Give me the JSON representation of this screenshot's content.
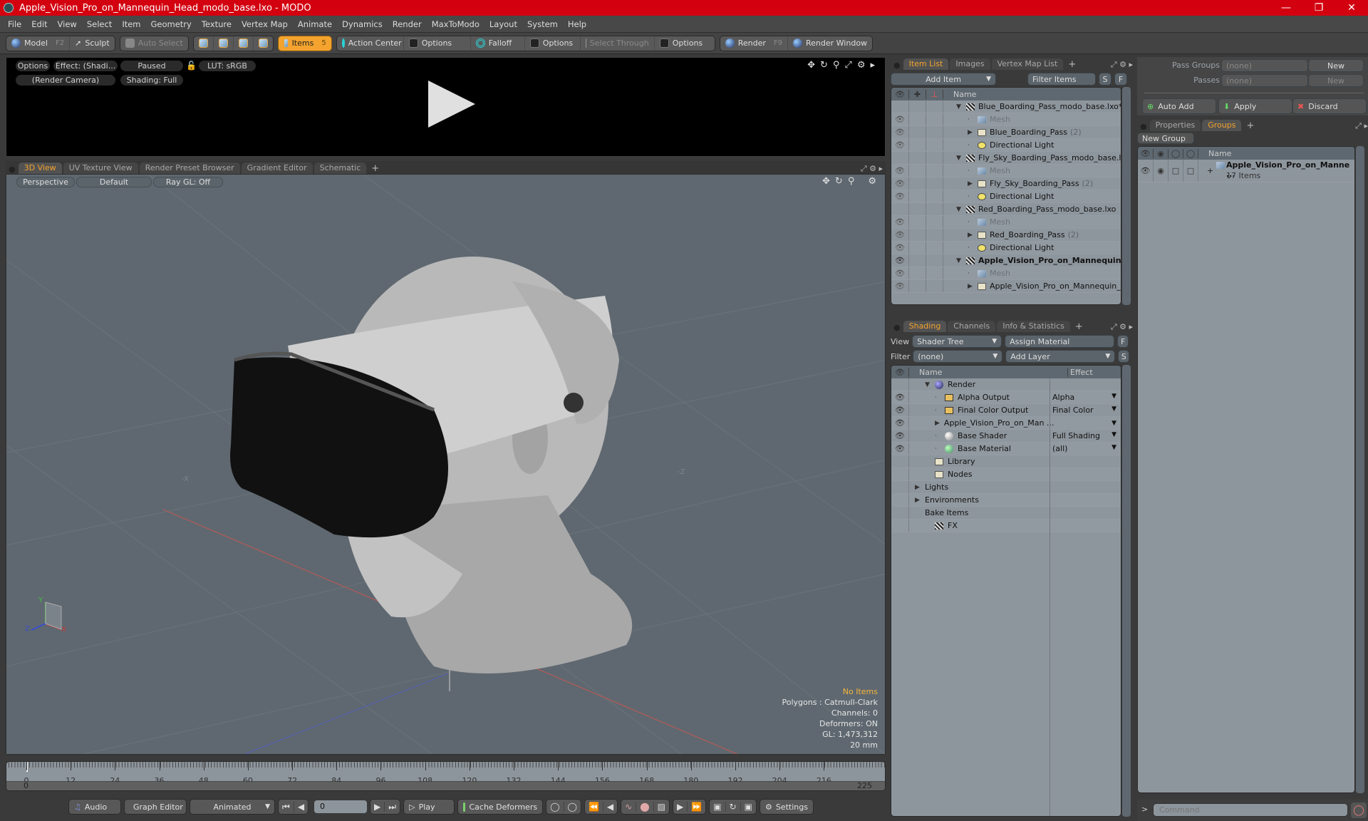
{
  "window": {
    "title": "Apple_Vision_Pro_on_Mannequin_Head_modo_base.lxo - MODO",
    "controls": [
      "minimize",
      "maximize",
      "close"
    ]
  },
  "menubar": [
    "File",
    "Edit",
    "View",
    "Select",
    "Item",
    "Geometry",
    "Texture",
    "Vertex Map",
    "Animate",
    "Dynamics",
    "Render",
    "MaxToModo",
    "Layout",
    "System",
    "Help"
  ],
  "toolbar": {
    "model": "Model",
    "model_key": "F2",
    "sculpt": "Sculpt",
    "auto_select": "Auto Select",
    "items": "Items",
    "items_key": "5",
    "action_center": "Action Center",
    "options1": "Options",
    "falloff": "Falloff",
    "options2": "Options",
    "select_through": "Select Through",
    "options3": "Options",
    "render": "Render",
    "render_key": "F9",
    "render_window": "Render Window"
  },
  "preview": {
    "options": "Options",
    "effect": "Effect: (Shadi...",
    "status": "Paused",
    "lut": "LUT: sRGB",
    "camera": "(Render Camera)",
    "shading": "Shading: Full"
  },
  "viewport_tabs": [
    {
      "label": "3D View",
      "active": true
    },
    {
      "label": "UV Texture View",
      "active": false
    },
    {
      "label": "Render Preset Browser",
      "active": false
    },
    {
      "label": "Gradient Editor",
      "active": false
    },
    {
      "label": "Schematic",
      "active": false
    }
  ],
  "viewport": {
    "view": "Perspective",
    "style": "Default",
    "raygl": "Ray GL: Off",
    "info": {
      "selection": "No Items",
      "polygons": "Polygons : Catmull-Clark",
      "channels": "Channels: 0",
      "deformers": "Deformers: ON",
      "gl": "GL: 1,473,312",
      "scale": "20 mm"
    },
    "axis_labels": {
      "x": "X",
      "y": "Y",
      "z": "Z"
    }
  },
  "timeline": {
    "ticks": [
      "0",
      "12",
      "24",
      "36",
      "48",
      "60",
      "72",
      "84",
      "96",
      "108",
      "120",
      "132",
      "144",
      "156",
      "168",
      "180",
      "192",
      "204",
      "216"
    ],
    "range_start": "0",
    "range_end": "225",
    "current_frame": "0"
  },
  "bottombar": {
    "audio": "Audio",
    "graph_editor": "Graph Editor",
    "mode": "Animated",
    "frame": "0",
    "play": "Play",
    "cache_deformers": "Cache Deformers",
    "settings": "Settings"
  },
  "item_list": {
    "tabs": [
      {
        "label": "Item List",
        "active": true
      },
      {
        "label": "Images",
        "active": false
      },
      {
        "label": "Vertex Map List",
        "active": false
      }
    ],
    "add_item": "Add Item",
    "filter_placeholder": "Filter Items",
    "s_btn": "S",
    "f_btn": "F",
    "col_name": "Name",
    "rows": [
      {
        "indent": 0,
        "expander": "open",
        "icon": "scene",
        "label": "Blue_Boarding_Pass_modo_base.lxo*",
        "count": "",
        "eye": false,
        "style": ""
      },
      {
        "indent": 1,
        "expander": "none",
        "icon": "mesh",
        "label": "Mesh",
        "count": "",
        "eye": true,
        "style": "dim"
      },
      {
        "indent": 1,
        "expander": "closed",
        "icon": "group",
        "label": "Blue_Boarding_Pass",
        "count": "(2)",
        "eye": true,
        "style": ""
      },
      {
        "indent": 1,
        "expander": "none",
        "icon": "light",
        "label": "Directional Light",
        "count": "",
        "eye": true,
        "style": ""
      },
      {
        "indent": 0,
        "expander": "open",
        "icon": "scene",
        "label": "Fly_Sky_Boarding_Pass_modo_base.lxo",
        "count": "",
        "eye": false,
        "style": ""
      },
      {
        "indent": 1,
        "expander": "none",
        "icon": "mesh",
        "label": "Mesh",
        "count": "",
        "eye": true,
        "style": "dim"
      },
      {
        "indent": 1,
        "expander": "closed",
        "icon": "group",
        "label": "Fly_Sky_Boarding_Pass",
        "count": "(2)",
        "eye": true,
        "style": ""
      },
      {
        "indent": 1,
        "expander": "none",
        "icon": "light",
        "label": "Directional Light",
        "count": "",
        "eye": true,
        "style": ""
      },
      {
        "indent": 0,
        "expander": "open",
        "icon": "scene",
        "label": "Red_Boarding_Pass_modo_base.lxo",
        "count": "",
        "eye": false,
        "style": ""
      },
      {
        "indent": 1,
        "expander": "none",
        "icon": "mesh",
        "label": "Mesh",
        "count": "",
        "eye": true,
        "style": "dim"
      },
      {
        "indent": 1,
        "expander": "closed",
        "icon": "group",
        "label": "Red_Boarding_Pass",
        "count": "(2)",
        "eye": true,
        "style": ""
      },
      {
        "indent": 1,
        "expander": "none",
        "icon": "light",
        "label": "Directional Light",
        "count": "",
        "eye": true,
        "style": ""
      },
      {
        "indent": 0,
        "expander": "open",
        "icon": "scene",
        "label": "Apple_Vision_Pro_on_Mannequin ...",
        "count": "",
        "eye": true,
        "style": "bold"
      },
      {
        "indent": 1,
        "expander": "none",
        "icon": "mesh",
        "label": "Mesh",
        "count": "",
        "eye": true,
        "style": "dim"
      },
      {
        "indent": 1,
        "expander": "closed",
        "icon": "group",
        "label": "Apple_Vision_Pro_on_Mannequin_He ...",
        "count": "",
        "eye": true,
        "style": ""
      }
    ]
  },
  "shading": {
    "tabs": [
      {
        "label": "Shading",
        "active": true
      },
      {
        "label": "Channels",
        "active": false
      },
      {
        "label": "Info & Statistics",
        "active": false
      }
    ],
    "view_label": "View",
    "view_value": "Shader Tree",
    "assign_material": "Assign Material",
    "filter_label": "Filter",
    "filter_value": "(none)",
    "add_layer": "Add Layer",
    "f_btn": "F",
    "s_btn": "S",
    "col_name": "Name",
    "col_effect": "Effect",
    "rows": [
      {
        "indent": 0,
        "expander": "open",
        "icon": "render",
        "label": "Render",
        "effect": "",
        "eye": false,
        "dropdown": false
      },
      {
        "indent": 1,
        "expander": "none",
        "icon": "output",
        "label": "Alpha Output",
        "effect": "Alpha",
        "eye": true,
        "dropdown": true
      },
      {
        "indent": 1,
        "expander": "none",
        "icon": "output",
        "label": "Final Color Output",
        "effect": "Final Color",
        "eye": true,
        "dropdown": true
      },
      {
        "indent": 1,
        "expander": "closed",
        "icon": "material-group",
        "label": "Apple_Vision_Pro_on_Man ...",
        "effect": "",
        "eye": true,
        "dropdown": true
      },
      {
        "indent": 1,
        "expander": "none",
        "icon": "shader",
        "label": "Base Shader",
        "effect": "Full Shading",
        "eye": true,
        "dropdown": true
      },
      {
        "indent": 1,
        "expander": "none",
        "icon": "material",
        "label": "Base Material",
        "effect": "(all)",
        "eye": true,
        "dropdown": true
      },
      {
        "indent": 0,
        "expander": "none",
        "icon": "folder",
        "label": "Library",
        "effect": "",
        "eye": false,
        "dropdown": false
      },
      {
        "indent": 0,
        "expander": "none",
        "icon": "folder",
        "label": "Nodes",
        "effect": "",
        "eye": false,
        "dropdown": false
      },
      {
        "indent": -1,
        "expander": "closed",
        "icon": "",
        "label": "Lights",
        "effect": "",
        "eye": false,
        "dropdown": false
      },
      {
        "indent": -1,
        "expander": "closed",
        "icon": "",
        "label": "Environments",
        "effect": "",
        "eye": false,
        "dropdown": false
      },
      {
        "indent": -1,
        "expander": "none",
        "icon": "",
        "label": "Bake Items",
        "effect": "",
        "eye": false,
        "dropdown": false
      },
      {
        "indent": 0,
        "expander": "none",
        "icon": "scene",
        "label": "FX",
        "effect": "",
        "eye": false,
        "dropdown": false
      }
    ]
  },
  "passes": {
    "pass_groups_label": "Pass Groups",
    "pass_groups_value": "(none)",
    "passes_label": "Passes",
    "passes_value": "(none)",
    "new1": "New",
    "new2": "New",
    "auto_add": "Auto Add",
    "apply": "Apply",
    "discard": "Discard"
  },
  "groups": {
    "tabs": [
      {
        "label": "Properties",
        "active": false
      },
      {
        "label": "Groups",
        "active": true
      }
    ],
    "new_group": "New Group",
    "col_name": "Name",
    "items": [
      {
        "label": "Apple_Vision_Pro_on_Manne ...",
        "sub": "17 Items"
      }
    ]
  },
  "command": {
    "prompt": ">",
    "placeholder": "Command"
  }
}
